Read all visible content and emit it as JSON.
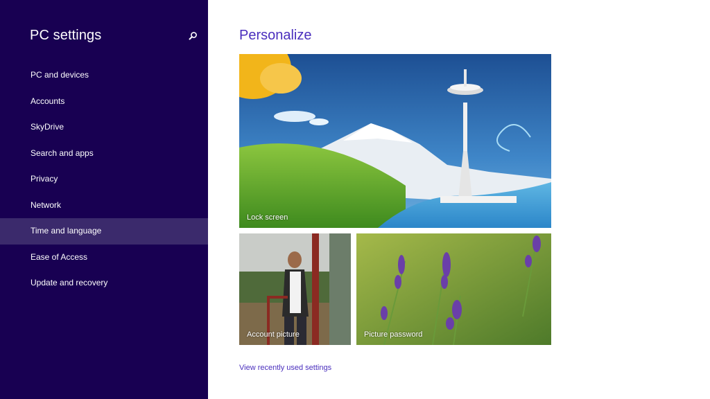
{
  "sidebar": {
    "title": "PC settings",
    "search_icon": "search-icon",
    "items": [
      {
        "label": "PC and devices"
      },
      {
        "label": "Accounts"
      },
      {
        "label": "SkyDrive"
      },
      {
        "label": "Search and apps"
      },
      {
        "label": "Privacy"
      },
      {
        "label": "Network"
      },
      {
        "label": "Time and language",
        "selected": true
      },
      {
        "label": "Ease of Access"
      },
      {
        "label": "Update and recovery"
      }
    ]
  },
  "main": {
    "title": "Personalize",
    "tiles": {
      "lock_screen": "Lock screen",
      "account_picture": "Account picture",
      "picture_password": "Picture password"
    },
    "recent_link": "View recently used settings"
  },
  "colors": {
    "sidebar_bg": "#180052",
    "selected_bg": "#3b2a6c",
    "accent": "#4a2ebd"
  }
}
